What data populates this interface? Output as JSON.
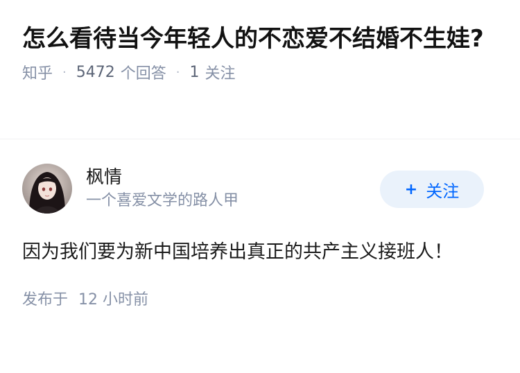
{
  "question": {
    "title": "怎么看待当今年轻人的不恋爱不结婚不生娃?",
    "source": "知乎",
    "answer_count": "5472",
    "answer_label": "个回答",
    "follow_count": "1",
    "follow_label": "关注"
  },
  "answer": {
    "author_name": "枫情",
    "author_bio": "一个喜爱文学的路人甲",
    "follow_button": {
      "icon": "plus-icon",
      "label": "关注",
      "color": "#0066ff",
      "background": "#eaf2fb"
    },
    "content": "因为我们要为新中国培养出真正的共产主义接班人！",
    "published_label": "发布于",
    "published_time": "12 小时前"
  }
}
